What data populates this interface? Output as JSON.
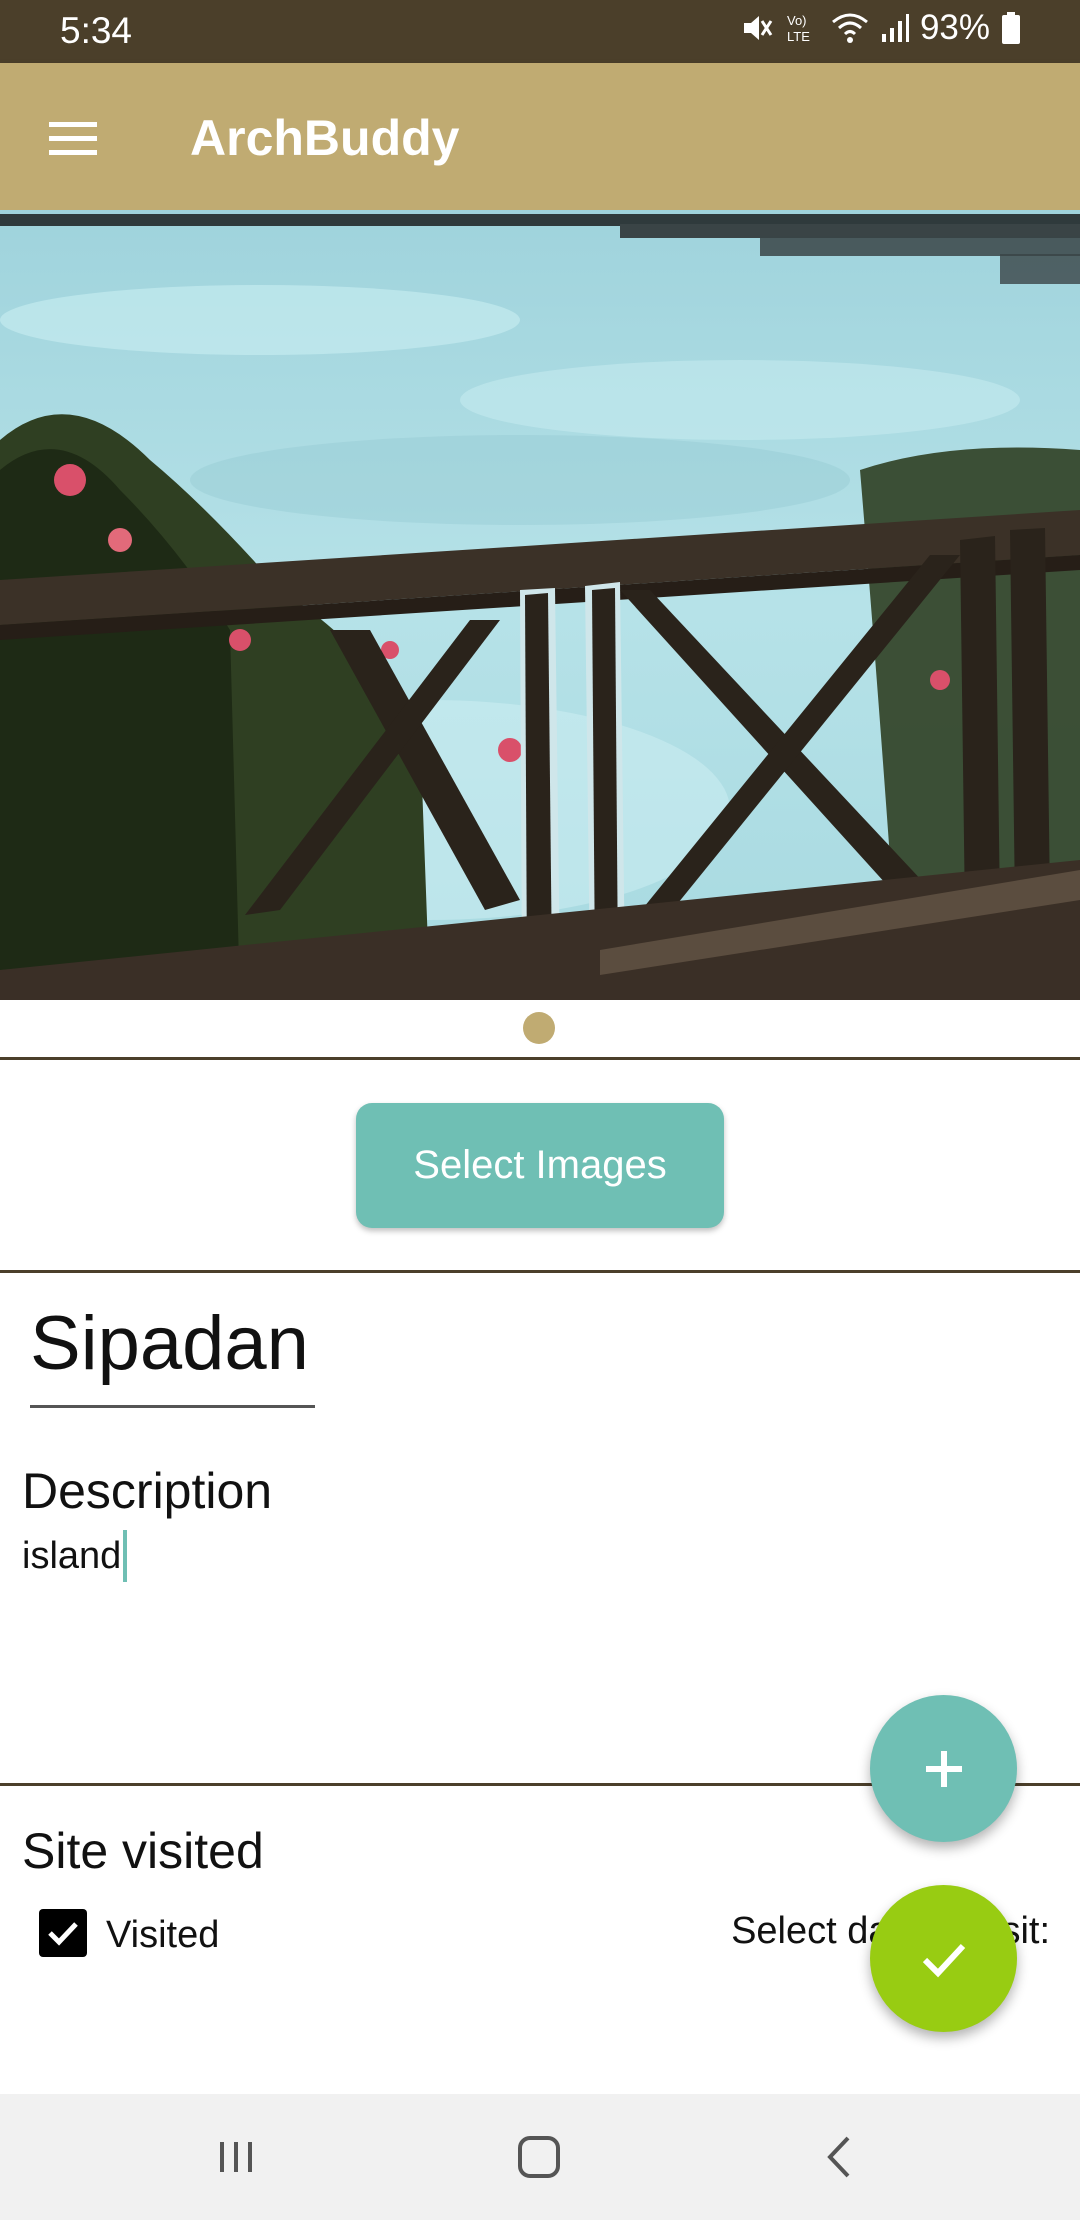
{
  "status_bar": {
    "time": "5:34",
    "battery_percent": "93%",
    "icons": [
      "mute-icon",
      "volte-icon",
      "wifi-icon",
      "signal-icon",
      "battery-icon"
    ]
  },
  "app_bar": {
    "title": "ArchBuddy",
    "menu_icon": "hamburger-menu-icon",
    "background_color": "#c0ab72"
  },
  "gallery": {
    "image_subject": "sea view from wooden railing with flowers",
    "pages": 1,
    "current_page": 1
  },
  "actions": {
    "select_images_label": "Select Images"
  },
  "site": {
    "title": "Sipadan",
    "description_label": "Description",
    "description_value": "island",
    "visited_section_label": "Site visited",
    "visited_checkbox_label": "Visited",
    "visited_checked": true,
    "select_date_label": "Select date of visit:"
  },
  "fabs": {
    "add_icon": "plus-icon",
    "save_icon": "check-icon",
    "add_color": "#6fbfb4",
    "save_color": "#98cc12"
  },
  "nav_bar": {
    "icons": [
      "recents-icon",
      "home-icon",
      "back-icon"
    ]
  },
  "colors": {
    "status_bar": "#4b3f2a",
    "accent_teal": "#6fbfb4",
    "accent_green": "#98cc12",
    "brand_gold": "#c0ab72"
  }
}
